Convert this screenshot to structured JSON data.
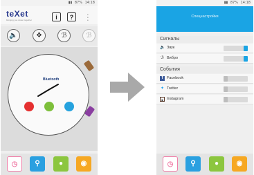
{
  "colors": {
    "accent_blue": "#1aa4e4",
    "dot_red": "#e53030",
    "dot_green": "#7dbf3b",
    "dot_blue": "#25a2de",
    "nav_pink": "#f07fa8",
    "nav_blue": "#2aa0e0",
    "nav_green": "#8cc63f",
    "nav_orange": "#f6a823",
    "arrow_gray": "#a9a9a9"
  },
  "left_screen": {
    "status": {
      "battery": "87%",
      "time": "14:18"
    },
    "logo": "teXet",
    "logo_tagline": "bringing you closer together",
    "info_button": "i",
    "help_button": "?",
    "toggle_icons": [
      "speaker-icon",
      "bulb-icon",
      "bluetooth-icon",
      "bluetooth-small-icon"
    ],
    "watch_brand": "Bluetooth",
    "dots": [
      "red",
      "green",
      "blue"
    ],
    "nav_icons": [
      "clock-icon",
      "search-icon",
      "pin-icon",
      "camera-icon"
    ]
  },
  "right_screen": {
    "status": {
      "battery": "87%",
      "time": "14:18"
    },
    "header_title": "Спецнастройки",
    "sections": [
      {
        "title": "Сигналы",
        "items": [
          {
            "label": "Звук",
            "icon": "speaker-icon",
            "on": true
          },
          {
            "label": "Вибро",
            "icon": "bluetooth-icon",
            "on": true
          }
        ]
      },
      {
        "title": "События",
        "items": [
          {
            "label": "Facebook",
            "icon": "facebook-icon",
            "on": false
          },
          {
            "label": "Twitter",
            "icon": "twitter-icon",
            "on": false
          },
          {
            "label": "Instagram",
            "icon": "instagram-icon",
            "on": false
          }
        ]
      }
    ],
    "nav_icons": [
      "clock-icon",
      "search-icon",
      "pin-icon",
      "camera-icon"
    ]
  }
}
